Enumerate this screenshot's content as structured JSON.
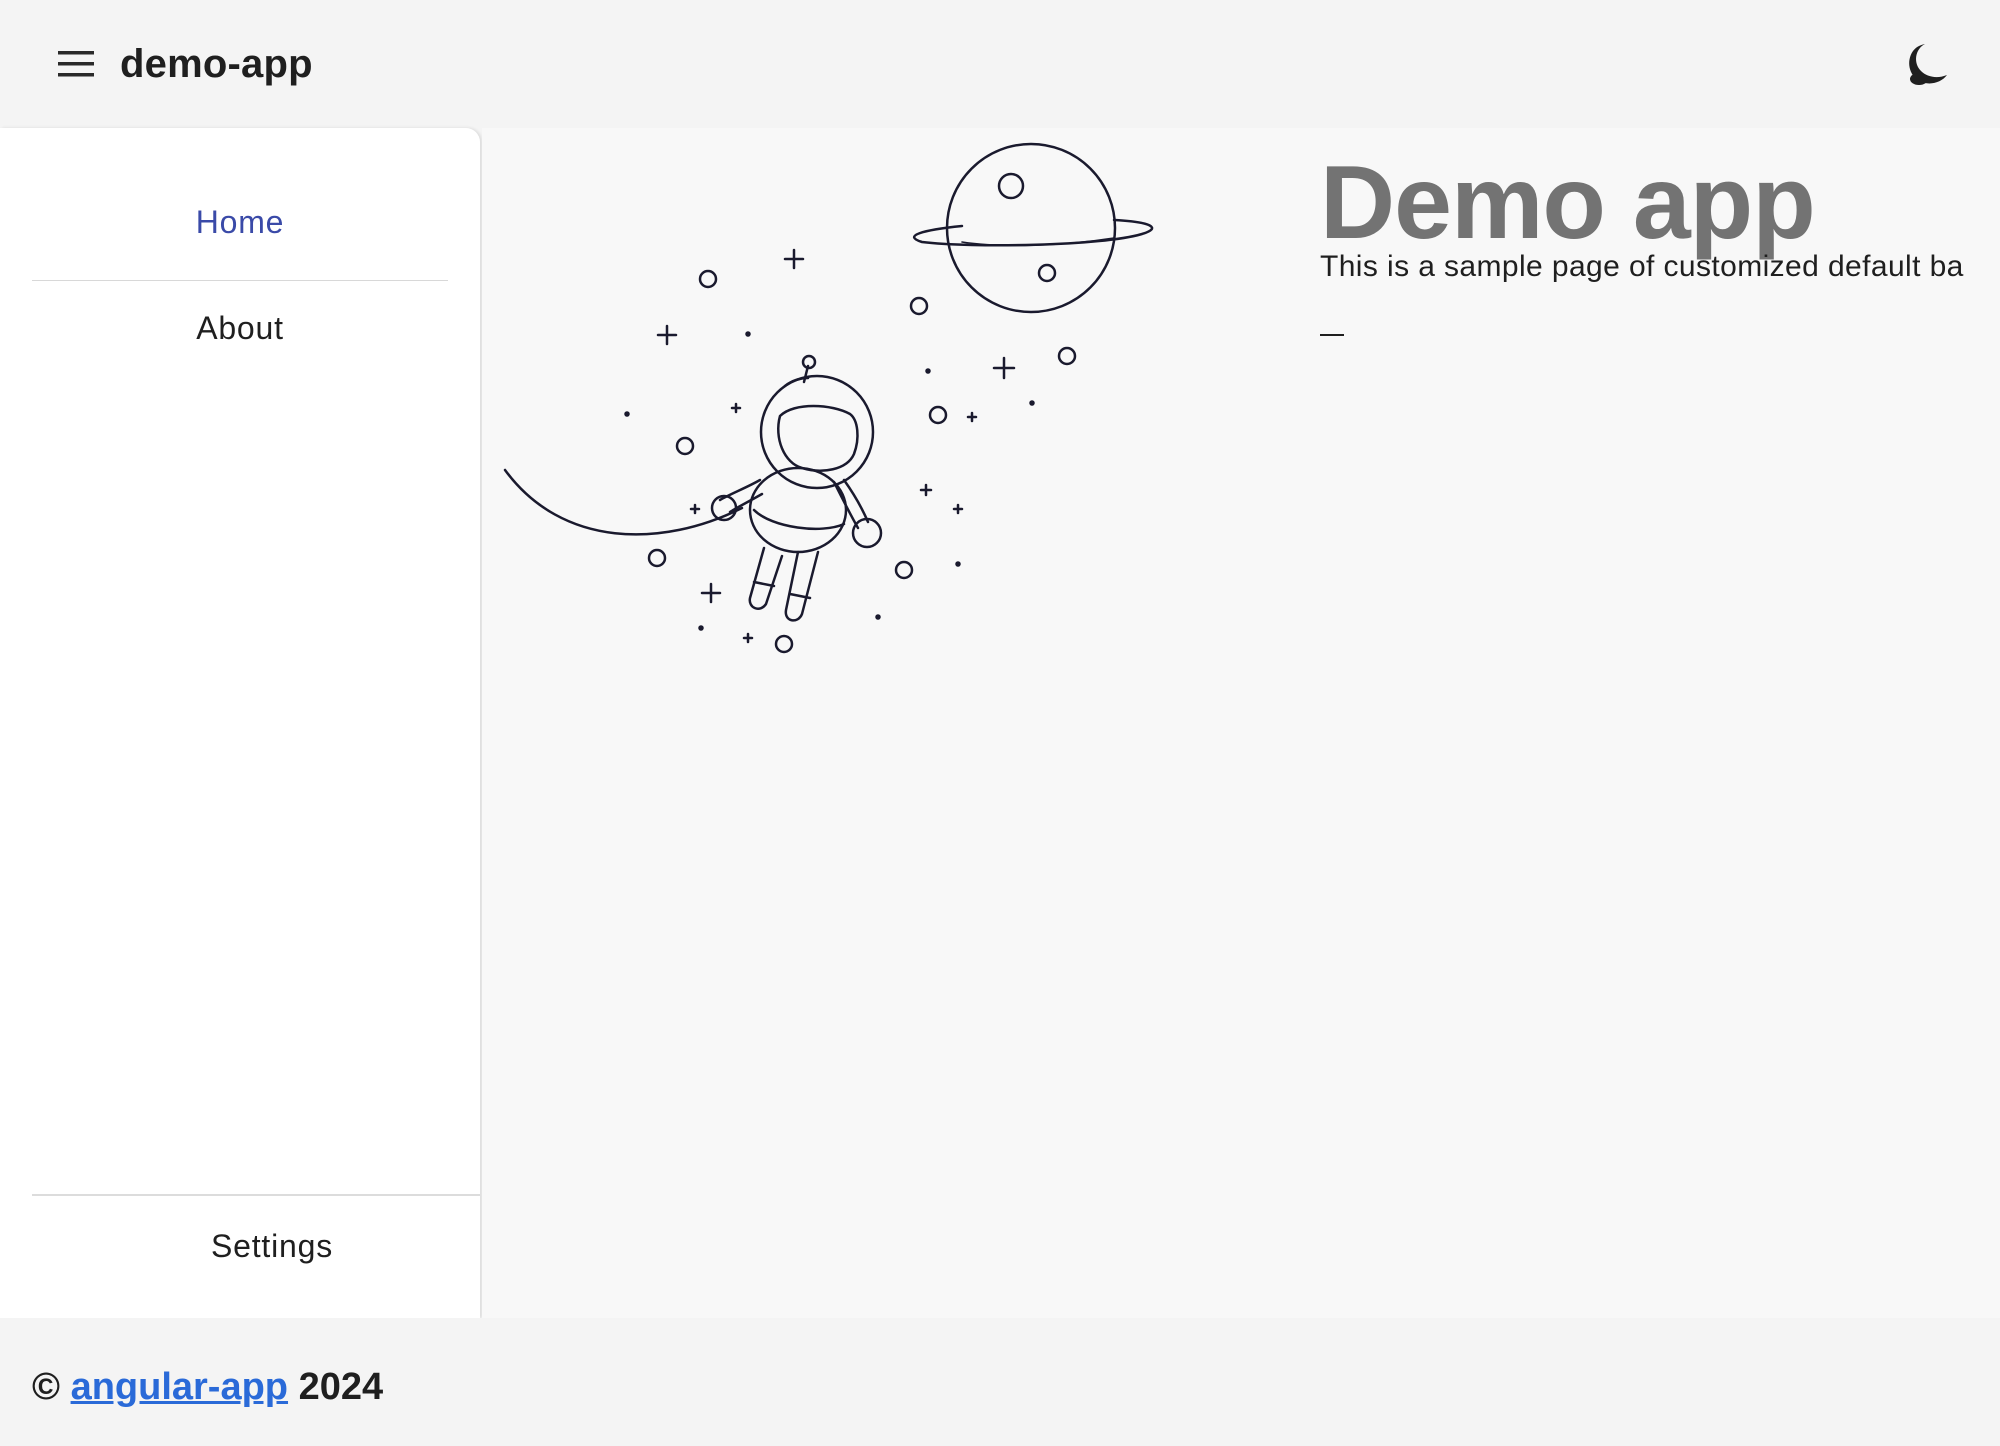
{
  "toolbar": {
    "title": "demo-app",
    "menu_icon": "menu-icon",
    "theme_icon": "moon-icon"
  },
  "sidenav": {
    "items": [
      {
        "label": "Home",
        "active": true
      },
      {
        "label": "About",
        "active": false
      }
    ],
    "settings_label": "Settings"
  },
  "main": {
    "title": "Demo app",
    "description": "This is a sample page of customized default ba",
    "illustration": "astronaut-illustration"
  },
  "footer": {
    "copyright_symbol": "©",
    "link_text": "angular-app",
    "year": "2024"
  },
  "colors": {
    "active_nav": "#3a4aa8",
    "link": "#2a6ad8",
    "hero_title": "#737373",
    "background": "#f4f4f4"
  }
}
